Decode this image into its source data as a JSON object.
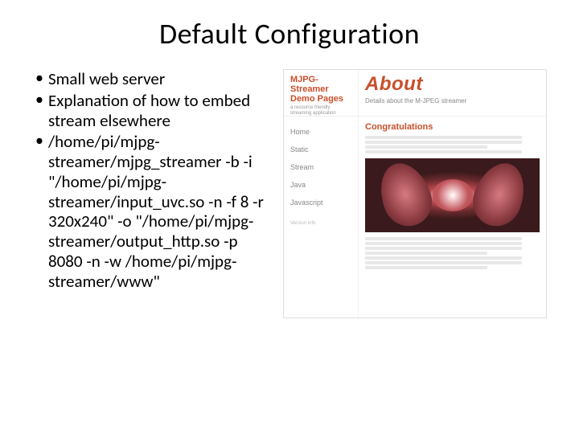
{
  "title": "Default Configuration",
  "bullets": [
    "Small web server",
    "Explanation of how to embed stream elsewhere",
    "/home/pi/mjpg-streamer/mjpg_streamer -b -i \"/home/pi/mjpg-streamer/input_uvc.so -n -f 8 -r 320x240\" -o \"/home/pi/mjpg-streamer/output_http.so -p 8080 -n -w /home/pi/mjpg-streamer/www\""
  ],
  "screenshot": {
    "logo_line1": "MJPG-Streamer",
    "logo_line2": "Demo Pages",
    "logo_sub": "a resource friendly streaming application",
    "about_title": "About",
    "about_sub": "Details about the M-JPEG streamer",
    "nav": [
      "Home",
      "Static",
      "Stream",
      "Java",
      "Javascript"
    ],
    "congrats": "Congratulations",
    "version": "Version info"
  }
}
